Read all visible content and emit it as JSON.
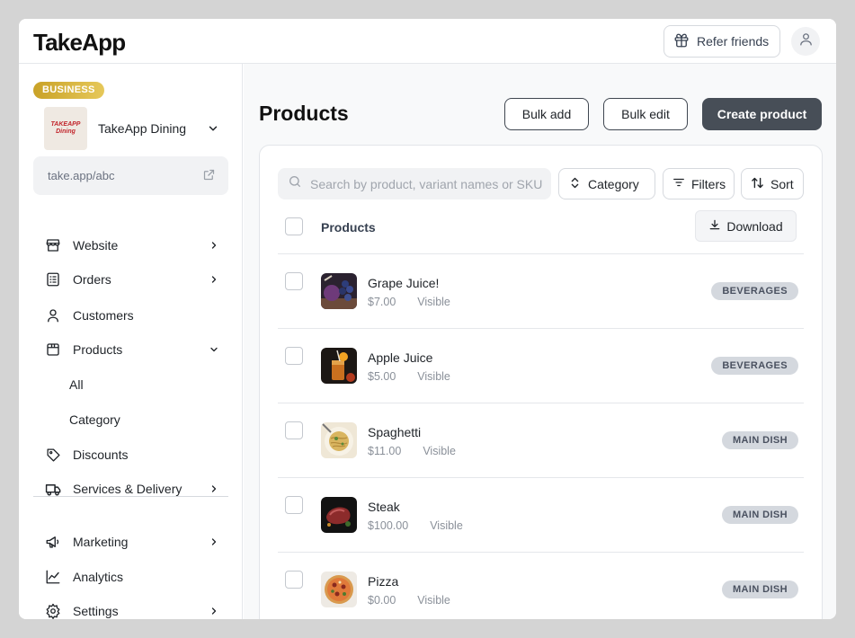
{
  "header": {
    "logo": "TakeApp",
    "refer_label": "Refer friends"
  },
  "sidebar": {
    "plan_badge": "BUSINESS",
    "store_logo_lines": [
      "TAKEAPP",
      "Dining"
    ],
    "store_name": "TakeApp Dining",
    "store_url": "take.app/abc",
    "nav": [
      {
        "label": "Website",
        "icon": "store-icon",
        "chevron": "right"
      },
      {
        "label": "Orders",
        "icon": "orders-list-icon",
        "chevron": "right"
      },
      {
        "label": "Customers",
        "icon": "user-icon",
        "chevron": ""
      },
      {
        "label": "Products",
        "icon": "box-icon",
        "chevron": "down"
      },
      {
        "label": "Discounts",
        "icon": "tag-icon",
        "chevron": ""
      },
      {
        "label": "Services & Delivery",
        "icon": "truck-icon",
        "chevron": "right"
      }
    ],
    "products_sub": [
      "All",
      "Category"
    ],
    "nav2": [
      {
        "label": "Marketing",
        "icon": "megaphone-icon",
        "chevron": "right"
      },
      {
        "label": "Analytics",
        "icon": "chart-line-icon",
        "chevron": ""
      },
      {
        "label": "Settings",
        "icon": "gear-icon",
        "chevron": "right"
      }
    ]
  },
  "main": {
    "title": "Products",
    "bulk_add": "Bulk add",
    "bulk_edit": "Bulk edit",
    "create": "Create product",
    "search_placeholder": "Search by product, variant names or SKU",
    "filter_category": "Category",
    "filter_filters": "Filters",
    "filter_sort": "Sort",
    "column_products": "Products",
    "download": "Download",
    "products": [
      {
        "name": "Grape Juice!",
        "price": "$7.00",
        "status": "Visible",
        "category": "BEVERAGES",
        "thumb": "grape"
      },
      {
        "name": "Apple Juice",
        "price": "$5.00",
        "status": "Visible",
        "category": "BEVERAGES",
        "thumb": "apple"
      },
      {
        "name": "Spaghetti",
        "price": "$11.00",
        "status": "Visible",
        "category": "MAIN DISH",
        "thumb": "spaghetti"
      },
      {
        "name": "Steak",
        "price": "$100.00",
        "status": "Visible",
        "category": "MAIN DISH",
        "thumb": "steak"
      },
      {
        "name": "Pizza",
        "price": "$0.00",
        "status": "Visible",
        "category": "MAIN DISH",
        "thumb": "pizza"
      }
    ]
  },
  "colors": {
    "accent_dark": "#474e57",
    "badge_gold": "#d4b03c",
    "tag_bg": "#d4d8de"
  }
}
